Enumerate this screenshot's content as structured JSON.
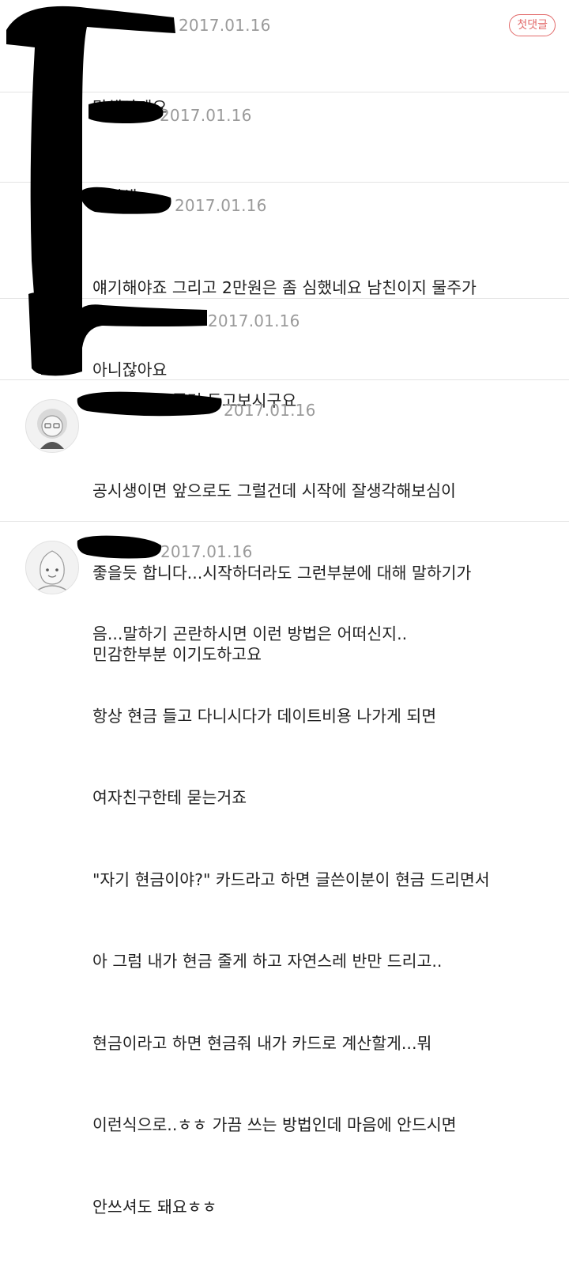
{
  "badge": {
    "label": "첫댓글"
  },
  "comments": [
    {
      "date": "2017.01.16",
      "lines": [
        "말해야돼요"
      ]
    },
    {
      "date": "2017.01.16",
      "lines": [
        "공시생 ㅠ"
      ]
    },
    {
      "date": "2017.01.16",
      "lines": [
        "얘기해야죠 그리고 2만원은 좀 심했네요 남친이지 물주가",
        "아니잖아요"
      ]
    },
    {
      "date": "2017.01.16",
      "lines": [
        "말해야되요 좀더 두고보시구요"
      ]
    },
    {
      "date": "2017.01.16",
      "lines": [
        "공시생이면 앞으로도 그럴건데 시작에 잘생각해보심이",
        "좋을듯 합니다...시작하더라도 그런부분에 대해 말하기가",
        "민감한부분 이기도하고요"
      ]
    },
    {
      "date": "2017.01.16",
      "lines": [
        "음...말하기 곤란하시면 이런 방법은 어떠신지..",
        "항상 현금 들고 다니시다가 데이트비용 나가게 되면",
        "여자친구한테 묻는거죠",
        "\"자기 현금이야?\" 카드라고 하면 글쓴이분이 현금 드리면서",
        "아 그럼 내가 현금 줄게 하고 자연스레 반만 드리고..",
        "현금이라고 하면 현금줘 내가 카드로 계산할게...뭐",
        "이런식으로..ㅎㅎ 가끔 쓰는 방법인데 마음에 안드시면",
        "안쓰셔도 돼요ㅎㅎ"
      ]
    }
  ]
}
